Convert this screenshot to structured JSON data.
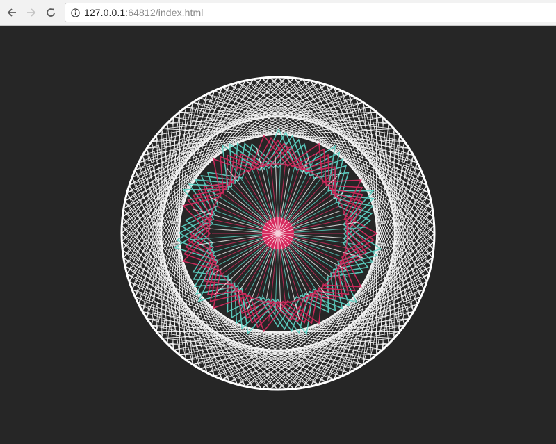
{
  "browser": {
    "url_host": "127.0.0.1",
    "url_rest": ":64812/index.html",
    "icons": {
      "back": "arrow-left-icon",
      "forward": "arrow-right-icon",
      "reload": "reload-icon",
      "site_info": "info-circle-icon"
    }
  },
  "canvas": {
    "background": "#262626",
    "colors": {
      "mesh": "#ffffff",
      "accent_pink": "#d62a5e",
      "accent_teal": "#5fd6c8",
      "spokes": "#ffffff"
    }
  }
}
